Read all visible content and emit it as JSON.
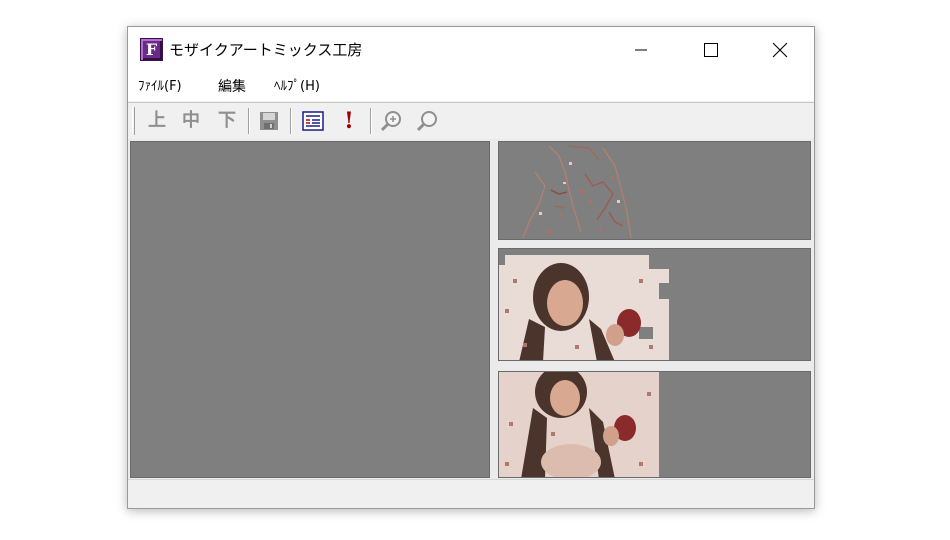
{
  "window": {
    "title": "モザイクアートミックス工房",
    "app_icon_letter": "F"
  },
  "menu": {
    "file": "ﾌｧｲﾙ(F)",
    "edit": "編集",
    "help": "ﾍﾙﾌﾟ(H)"
  },
  "toolbar": {
    "top_label": "上",
    "middle_label": "中",
    "bottom_label": "下",
    "execute_label": "!"
  },
  "icons": {
    "app": "app-logo-icon",
    "minimize": "minimize-icon",
    "maximize": "maximize-icon",
    "close": "close-icon",
    "save": "floppy-disk-icon",
    "list": "list-icon",
    "zoom_in": "zoom-in-icon",
    "zoom_out": "zoom-out-icon"
  },
  "colors": {
    "pane_gray": "#7f7f7f",
    "toolbar_disabled": "#8f8f8f",
    "execute_red": "#a00000",
    "app_icon_purple": "#6a2a8a"
  }
}
